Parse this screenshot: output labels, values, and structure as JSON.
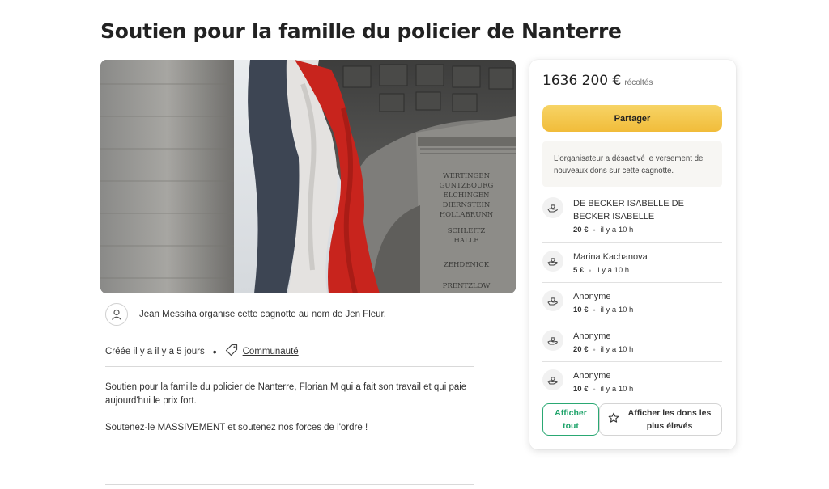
{
  "page": {
    "title": "Soutien pour la famille du policier de Nanterre"
  },
  "hero": {
    "monument_lines": [
      "WERTINGEN",
      "GUNTZBOURG",
      "ELCHINGEN",
      "DIERNSTEIN",
      "HOLLABRUNN",
      "SCHLEITZ",
      "HALLE",
      "ZEHDENICK",
      "PRENTZLOW"
    ]
  },
  "organizer": {
    "text": "Jean Messiha organise cette cagnotte au nom de Jen Fleur."
  },
  "meta": {
    "created": "Créée il y a il y a 5 jours",
    "separator": "•",
    "category": "Communauté"
  },
  "description": {
    "paragraph1": "Soutien pour la famille du policier de Nanterre, Florian.M qui a fait son travail et qui paie aujourd'hui le prix fort.",
    "paragraph2": "Soutenez-le MASSIVEMENT et soutenez nos forces de l'ordre !"
  },
  "card": {
    "amount": "1636 200 €",
    "amount_suffix": "récoltés",
    "share_label": "Partager",
    "notice": "L'organisateur a désactivé le versement de nouveaux dons sur cette cagnotte.",
    "donations": [
      {
        "name": "DE BECKER ISABELLE DE BECKER ISABELLE",
        "amount": "20 €",
        "time": "il y a 10 h"
      },
      {
        "name": "Marina Kachanova",
        "amount": "5 €",
        "time": "il y a 10 h"
      },
      {
        "name": "Anonyme",
        "amount": "10 €",
        "time": "il y a 10 h"
      },
      {
        "name": "Anonyme",
        "amount": "20 €",
        "time": "il y a 10 h"
      },
      {
        "name": "Anonyme",
        "amount": "10 €",
        "time": "il y a 10 h"
      }
    ],
    "show_all_label": "Afficher tout",
    "show_top_label": "Afficher les dons les plus élevés",
    "dot": "•"
  },
  "colors": {
    "share_button": "#f1bc3a",
    "show_all_green": "#1ea36a",
    "flag_red": "#c8241d"
  }
}
